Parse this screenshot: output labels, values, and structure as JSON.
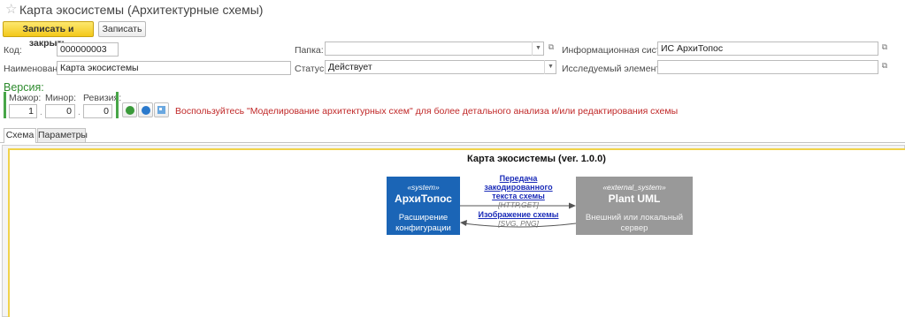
{
  "window": {
    "title": "Карта экосистемы (Архитектурные схемы)"
  },
  "toolbar": {
    "save_close": "Записать и закрыть",
    "save": "Записать"
  },
  "form": {
    "code_label": "Код:",
    "code_value": "000000003",
    "name_label": "Наименование:",
    "name_value": "Карта экосистемы",
    "folder_label": "Папка:",
    "folder_value": "",
    "status_label": "Статус:",
    "status_value": "Действует",
    "infosys_label": "Информационная система:",
    "infosys_value": "ИС АрхиТопос",
    "element_label": "Исследуемый элемент ИС:",
    "element_value": ""
  },
  "version": {
    "title": "Версия:",
    "major_label": "Мажор:",
    "major_value": "1",
    "minor_label": "Минор:",
    "minor_value": "0",
    "revision_label": "Ревизия:",
    "revision_value": "0",
    "separator": ".",
    "hint": "Воспользуйтесь \"Моделирование архитектурных схем\" для более детального анализа и/или редактирования схемы"
  },
  "tabs": [
    {
      "label": "Схема"
    },
    {
      "label": "Параметры"
    }
  ],
  "diagram": {
    "title": "Карта экосистемы (ver. 1.0.0)",
    "system": {
      "stereotype": "«system»",
      "name": "АрхиТопос",
      "desc1": "Расширение",
      "desc2": "конфигурации",
      "color": "#1b65b6"
    },
    "external": {
      "stereotype": "«external_system»",
      "name": "Plant UML",
      "desc1": "Внешний или локальный",
      "desc2": "сервер",
      "color": "#999999"
    },
    "rel1": {
      "line1": "Передача",
      "line2": "закодированного",
      "line3": "текста схемы",
      "tech": "[HTTP,GET]"
    },
    "rel2": {
      "line1": "Изображение схемы",
      "tech": "[SVG, PNG]"
    }
  },
  "colors": {
    "accent_yellow": "#f3c81a",
    "version_green": "#2e8b2e",
    "hint_red": "#c02828",
    "link_blue": "#1a2bb8"
  }
}
